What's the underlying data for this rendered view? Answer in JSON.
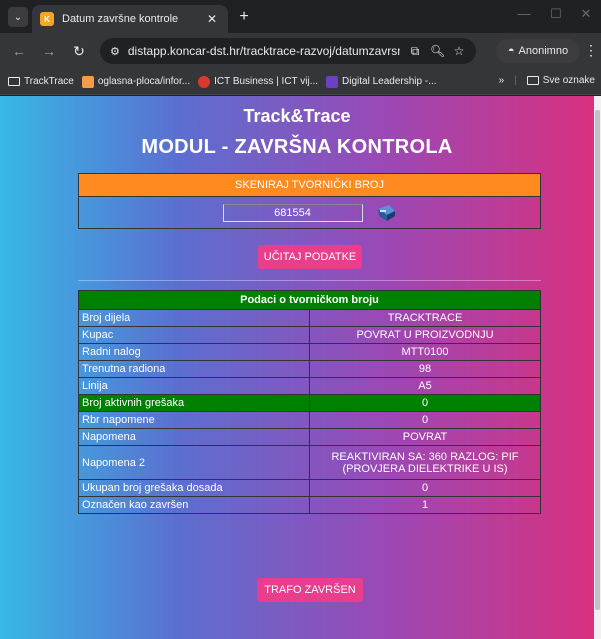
{
  "browser": {
    "tab_title": "Datum završne kontrole",
    "favicon_text": "K",
    "url": "distapp.koncar-dst.hr/tracktrace-razvoj/datumzavrsnak...",
    "incognito_label": "Anonimno",
    "bookmarks": [
      {
        "label": "TrackTrace",
        "icon": "folder-icon"
      },
      {
        "label": "oglasna-ploca/infor...",
        "icon": "site-icon",
        "color": "#f39c4a"
      },
      {
        "label": "ICT Business | ICT vij...",
        "icon": "site-icon",
        "color": "#d93a2b"
      },
      {
        "label": "Digital Leadership -...",
        "icon": "site-icon",
        "color": "#6c3fc4"
      }
    ],
    "overflow_label": "»",
    "all_bookmarks_label": "Sve oznake"
  },
  "page": {
    "title": "Track&Trace",
    "subtitle": "MODUL - ZAVRŠNA KONTROLA",
    "scan_header": "SKENIRAJ TVORNIČKI BROJ",
    "scan_value": "681554",
    "load_button": "UČITAJ PODATKE",
    "table_title": "Podaci o tvorničkom broju",
    "rows": [
      {
        "label": "Broj dijela",
        "value": "TRACKTRACE"
      },
      {
        "label": "Kupac",
        "value": "POVRAT U PROIZVODNJU"
      },
      {
        "label": "Radni nalog",
        "value": "MTT0100"
      },
      {
        "label": "Trenutna radiona",
        "value": "98"
      },
      {
        "label": "Linija",
        "value": "A5"
      },
      {
        "label": "Broj aktivnih grešaka",
        "value": "0"
      },
      {
        "label": "Rbr napomene",
        "value": "0"
      },
      {
        "label": "Napomena",
        "value": "POVRAT"
      },
      {
        "label": "Napomena 2",
        "value": "REAKTIVIRAN SA: 360 RAZLOG: PIF (PROVJERA DIELEKTRIKE U IS)"
      },
      {
        "label": "Ukupan broj grešaka dosada",
        "value": "0"
      },
      {
        "label": "Označen kao završen",
        "value": "1"
      }
    ],
    "done_button": "TRAFO ZAVRŠEN",
    "colors": {
      "scan_header": "#ff8a1f",
      "button": "#e83e8c",
      "highlight": "#008000"
    }
  }
}
